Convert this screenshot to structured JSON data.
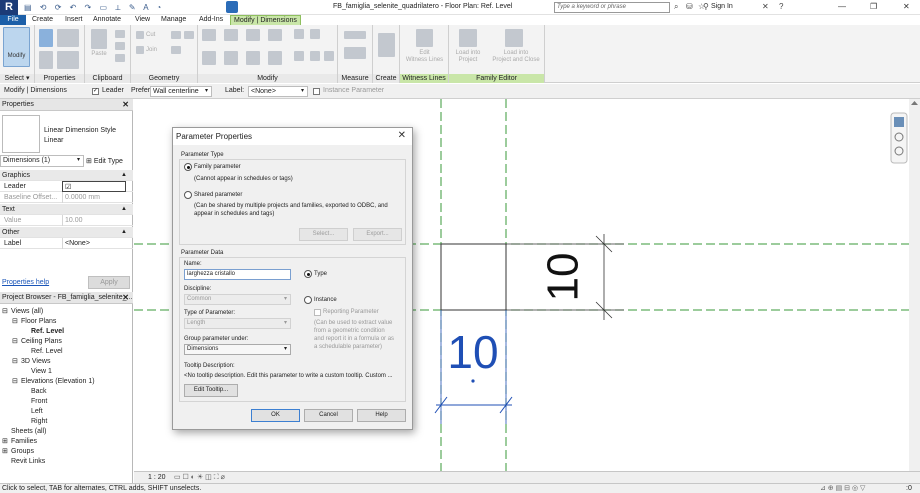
{
  "app": {
    "logo": "R",
    "window_title": "FB_famiglia_selenite_quadrilatero - Floor Plan: Ref. Level",
    "search_placeholder": "Type a keyword or phrase",
    "sign_in": "Sign In",
    "help": "?"
  },
  "ribbon_tabs": [
    "File",
    "Create",
    "Insert",
    "Annotate",
    "View",
    "Manage",
    "Add-Ins",
    "Modify | Dimensions"
  ],
  "ribbon_panels": {
    "select": "Select",
    "properties": "Properties",
    "clipboard": "Clipboard",
    "geometry": "Geometry",
    "modify": "Modify",
    "measure": "Measure",
    "create": "Create",
    "witness_lines": "Witness Lines",
    "family_editor": "Family Editor"
  },
  "ribbon_buttons": {
    "modify": "Modify",
    "paste": "Paste",
    "cut": "Cut",
    "join": "Join",
    "edit_witness_lines": [
      "Edit",
      "Witness Lines"
    ],
    "load_into_project": [
      "Load into",
      "Project"
    ],
    "load_into_project_close": [
      "Load into",
      "Project and Close"
    ]
  },
  "options_bar": {
    "context": "Modify | Dimensions",
    "leader_label": "Leader",
    "leader_checked": true,
    "prefer_label": "Prefer:",
    "prefer_value": "Wall centerline",
    "label_label": "Label:",
    "label_value": "<None>",
    "instance_parameter_label": "Instance Parameter"
  },
  "properties": {
    "title": "Properties",
    "type_name_line1": "Linear Dimension Style",
    "type_name_line2": "Linear",
    "selector": "Dimensions (1)",
    "edit_type": "Edit Type",
    "groups": [
      {
        "name": "Graphics",
        "rows": [
          {
            "key": "Leader",
            "value": "☑"
          },
          {
            "key": "Baseline Offset...",
            "value": "0.0000 mm"
          }
        ]
      },
      {
        "name": "Text",
        "rows": [
          {
            "key": "Value",
            "value": "10.00"
          }
        ]
      },
      {
        "name": "Other",
        "rows": [
          {
            "key": "Label",
            "value": "<None>"
          }
        ]
      }
    ],
    "help_link": "Properties help",
    "apply": "Apply"
  },
  "project_browser": {
    "title": "Project Browser - FB_famiglia_selenite_...",
    "items": [
      {
        "text": "Views (all)",
        "indent": 0,
        "toggle": "⊟",
        "bold": false
      },
      {
        "text": "Floor Plans",
        "indent": 1,
        "toggle": "⊟",
        "bold": false
      },
      {
        "text": "Ref. Level",
        "indent": 2,
        "toggle": "",
        "bold": true
      },
      {
        "text": "Ceiling Plans",
        "indent": 1,
        "toggle": "⊟",
        "bold": false
      },
      {
        "text": "Ref. Level",
        "indent": 2,
        "toggle": "",
        "bold": false
      },
      {
        "text": "3D Views",
        "indent": 1,
        "toggle": "⊟",
        "bold": false
      },
      {
        "text": "View 1",
        "indent": 2,
        "toggle": "",
        "bold": false
      },
      {
        "text": "Elevations (Elevation 1)",
        "indent": 1,
        "toggle": "⊟",
        "bold": false
      },
      {
        "text": "Back",
        "indent": 2,
        "toggle": "",
        "bold": false
      },
      {
        "text": "Front",
        "indent": 2,
        "toggle": "",
        "bold": false
      },
      {
        "text": "Left",
        "indent": 2,
        "toggle": "",
        "bold": false
      },
      {
        "text": "Right",
        "indent": 2,
        "toggle": "",
        "bold": false
      },
      {
        "text": "Sheets (all)",
        "indent": 0,
        "toggle": "",
        "bold": false
      },
      {
        "text": "Families",
        "indent": 0,
        "toggle": "⊞",
        "bold": false
      },
      {
        "text": "Groups",
        "indent": 0,
        "toggle": "⊞",
        "bold": false
      },
      {
        "text": "Revit Links",
        "indent": 0,
        "toggle": "",
        "bold": false
      }
    ]
  },
  "canvas": {
    "dim_vertical": "10",
    "dim_horizontal": "10",
    "scale": "1 : 20"
  },
  "status_text": "Click to select, TAB for alternates, CTRL adds, SHIFT unselects.",
  "status_right": ":0",
  "dialog": {
    "title": "Parameter Properties",
    "parameter_type_label": "Parameter Type",
    "family_parameter": "Family parameter",
    "family_parameter_desc": "(Cannot appear in schedules or tags)",
    "shared_parameter": "Shared parameter",
    "shared_parameter_desc_1": "(Can be shared by multiple projects and families, exported to ODBC, and",
    "shared_parameter_desc_2": "appear in schedules and tags)",
    "select_btn": "Select...",
    "export_btn": "Export...",
    "parameter_data_label": "Parameter Data",
    "name_label": "Name:",
    "name_value": "larghezza cristallo",
    "type_radio": "Type",
    "instance_radio": "Instance",
    "discipline_label": "Discipline:",
    "discipline_value": "Common",
    "type_of_parameter_label": "Type of Parameter:",
    "type_of_parameter_value": "Length",
    "reporting_parameter": "Reporting Parameter",
    "reporting_desc_1": "(Can be used to extract value",
    "reporting_desc_2": "from a geometric condition",
    "reporting_desc_3": "and report it in a formula or as",
    "reporting_desc_4": "a schedulable parameter)",
    "group_under_label": "Group parameter under:",
    "group_under_value": "Dimensions",
    "tooltip_label": "Tooltip Description:",
    "tooltip_value": "<No tooltip description. Edit this parameter to write a custom tooltip. Custom ...",
    "edit_tooltip_btn": "Edit Tooltip...",
    "ok": "OK",
    "cancel": "Cancel",
    "help": "Help"
  },
  "colors": {
    "accent_green": "#c9e6a8",
    "file_tab_blue": "#1c5fa8",
    "dimension_blue": "#1f4fb5",
    "ref_plane_green": "#2e8b2e"
  }
}
